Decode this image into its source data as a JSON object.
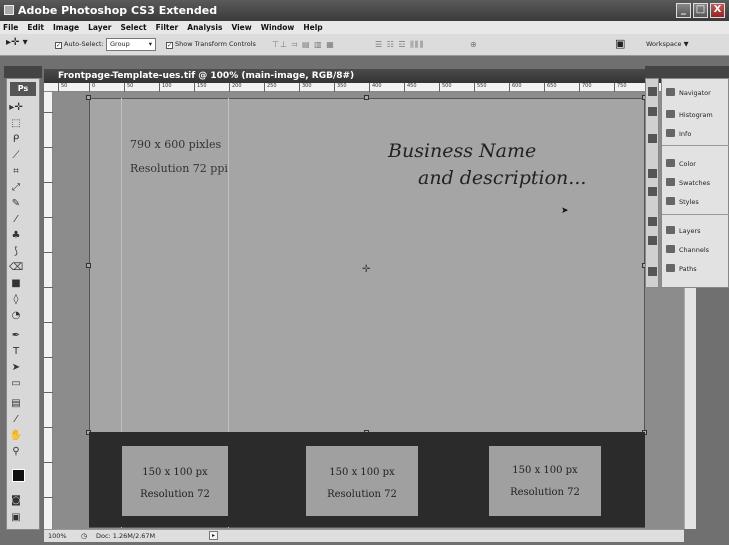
{
  "window": {
    "title": "Adobe Photoshop CS3 Extended",
    "minimize": "_",
    "maximize": "□",
    "close": "X"
  },
  "menu": [
    "File",
    "Edit",
    "Image",
    "Layer",
    "Select",
    "Filter",
    "Analysis",
    "View",
    "Window",
    "Help"
  ],
  "options": {
    "auto_select_label": "Auto-Select:",
    "auto_select_checked": true,
    "auto_select_value": "Group",
    "show_transform_label": "Show Transform Controls",
    "show_transform_checked": true,
    "workspace_label": "Workspace ▼"
  },
  "document": {
    "title": "Frontpage-Template-ues.tif @ 100% (main-image, RGB/8#)",
    "ruler_labels": [
      "50",
      "0",
      "50",
      "100",
      "150",
      "200",
      "250",
      "300",
      "350",
      "400",
      "450",
      "500",
      "550",
      "600",
      "650",
      "700",
      "750"
    ],
    "status_zoom": "100%",
    "status_doc": "Doc: 1.26M/2.67M"
  },
  "canvas": {
    "dim_line1": "790 x 600 pixles",
    "dim_line2": "Resolution 72 ppi",
    "business_line1": "Business Name",
    "business_line2": "and description...",
    "thumbs": [
      {
        "line1": "150 x 100 px",
        "line2": "Resolution 72"
      },
      {
        "line1": "150 x 100 px",
        "line2": "Resolution 72"
      },
      {
        "line1": "150 x 100 px",
        "line2": "Resolution 72"
      }
    ]
  },
  "panels": {
    "group1": [
      "Navigator",
      "Histogram",
      "Info"
    ],
    "group2": [
      "Color",
      "Swatches",
      "Styles"
    ],
    "group3": [
      "Layers",
      "Channels",
      "Paths"
    ]
  },
  "tools_logo": "Ps"
}
